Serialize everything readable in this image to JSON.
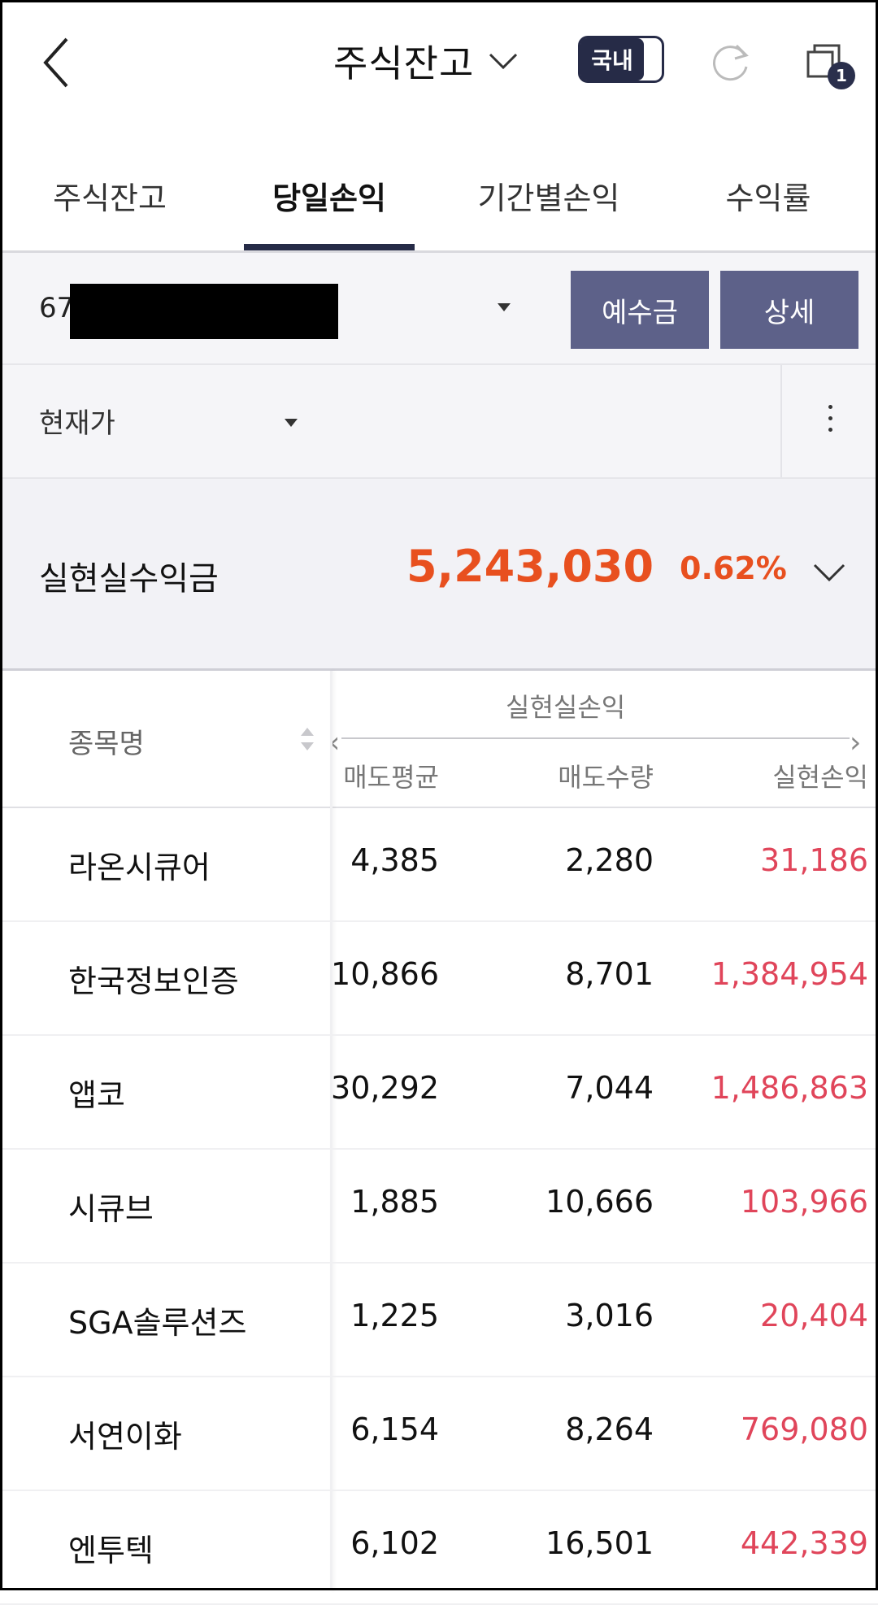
{
  "header": {
    "title": "주식잔고",
    "toggle_label": "국내",
    "badge_count": "1"
  },
  "tabs": [
    {
      "label": "주식잔고",
      "active": false
    },
    {
      "label": "당일손익",
      "active": true
    },
    {
      "label": "기간별손익",
      "active": false
    },
    {
      "label": "수익률",
      "active": false
    }
  ],
  "account": {
    "number_prefix": "67",
    "deposit_button": "예수금",
    "detail_button": "상세"
  },
  "price_selector": {
    "label": "현재가"
  },
  "summary": {
    "label": "실현실수익금",
    "value": "5,243,030",
    "rate": "0.62%",
    "accent_color": "#e8501f"
  },
  "table": {
    "name_header": "종목명",
    "group_header": "실현실손익",
    "columns": [
      "매도평균",
      "매도수량",
      "실현손익"
    ],
    "rows": [
      {
        "name": "라온시큐어",
        "avg": "4,385",
        "qty": "2,280",
        "pnl": "31,186"
      },
      {
        "name": "한국정보인증",
        "avg": "10,866",
        "qty": "8,701",
        "pnl": "1,384,954"
      },
      {
        "name": "앱코",
        "avg": "30,292",
        "qty": "7,044",
        "pnl": "1,486,863"
      },
      {
        "name": "시큐브",
        "avg": "1,885",
        "qty": "10,666",
        "pnl": "103,966"
      },
      {
        "name": "SGA솔루션즈",
        "avg": "1,225",
        "qty": "3,016",
        "pnl": "20,404"
      },
      {
        "name": "서연이화",
        "avg": "6,154",
        "qty": "8,264",
        "pnl": "769,080"
      },
      {
        "name": "엔투텍",
        "avg": "6,102",
        "qty": "16,501",
        "pnl": "442,339"
      }
    ],
    "pnl_color": "#e0455a"
  }
}
